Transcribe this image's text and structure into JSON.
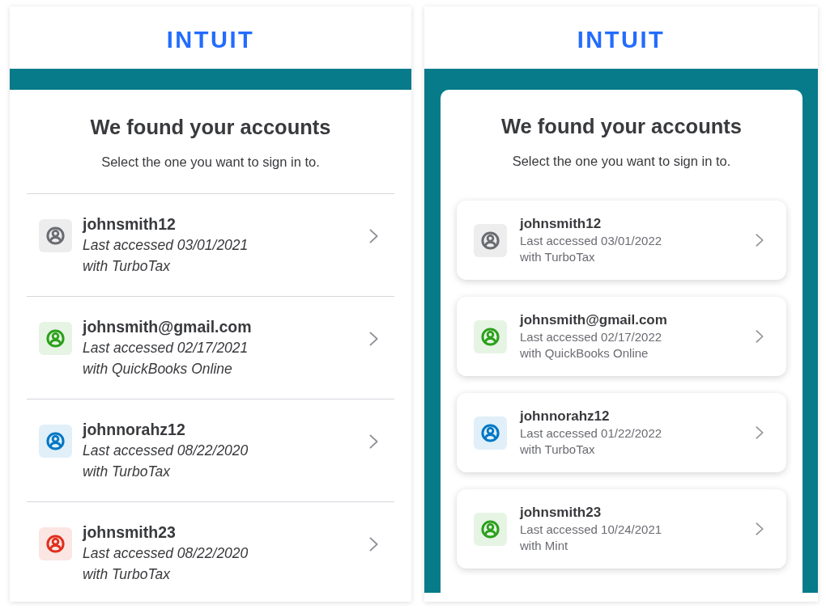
{
  "screens": [
    {
      "kind": "divided",
      "logo": "INTUIT",
      "title": "We found your accounts",
      "subtitle": "Select the one you want to sign in to.",
      "accounts": [
        {
          "username": "johnsmith12",
          "last_accessed": "Last accessed 03/01/2021",
          "product": "with TurboTax",
          "color": "#6b6c72"
        },
        {
          "username": "johnsmith@gmail.com",
          "last_accessed": "Last accessed 02/17/2021",
          "product": "with QuickBooks Online",
          "color": "#2ca01c"
        },
        {
          "username": "johnnorahz12",
          "last_accessed": "Last accessed 08/22/2020",
          "product": "with TurboTax",
          "color": "#0077c5"
        },
        {
          "username": "johnsmith23",
          "last_accessed": "Last accessed 08/22/2020",
          "product": "with TurboTax",
          "color": "#e0301e"
        }
      ]
    },
    {
      "kind": "cards",
      "logo": "INTUIT",
      "title": "We found your accounts",
      "subtitle": "Select the one you want to sign in to.",
      "accounts": [
        {
          "username": "johnsmith12",
          "last_accessed": "Last accessed 03/01/2022",
          "product": "with TurboTax",
          "color": "#6b6c72"
        },
        {
          "username": "johnsmith@gmail.com",
          "last_accessed": "Last accessed 02/17/2022",
          "product": "with QuickBooks Online",
          "color": "#2ca01c"
        },
        {
          "username": "johnnorahz12",
          "last_accessed": "Last accessed 01/22/2022",
          "product": "with TurboTax",
          "color": "#0077c5"
        },
        {
          "username": "johnsmith23",
          "last_accessed": "Last accessed 10/24/2021",
          "product": "with Mint",
          "color": "#2ca01c"
        }
      ]
    }
  ]
}
